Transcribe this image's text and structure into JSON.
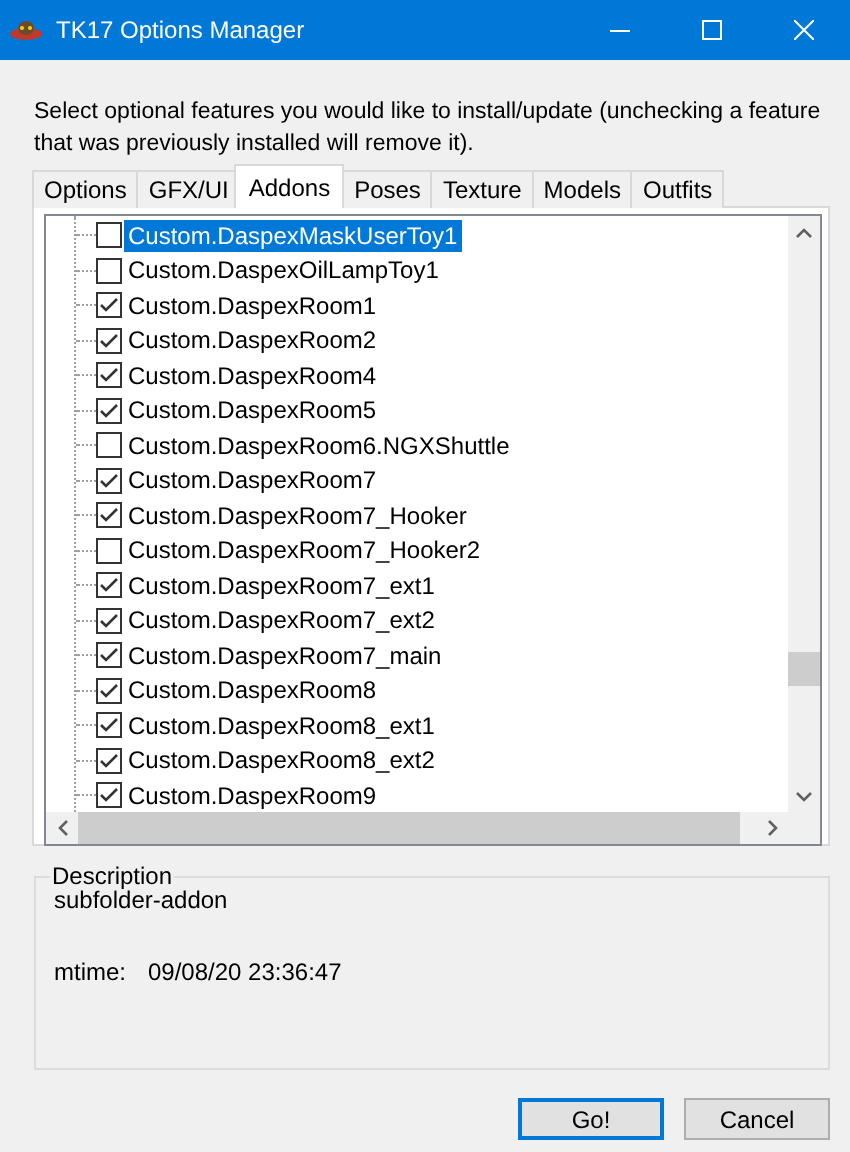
{
  "window": {
    "title": "TK17 Options Manager"
  },
  "instructions": "Select optional features you would like to install/update (unchecking a feature that was previously installed will remove it).",
  "tabs": [
    {
      "label": "Options",
      "selected": false
    },
    {
      "label": "GFX/UI",
      "selected": false
    },
    {
      "label": "Addons",
      "selected": true
    },
    {
      "label": "Poses",
      "selected": false
    },
    {
      "label": "Texture",
      "selected": false
    },
    {
      "label": "Models",
      "selected": false
    },
    {
      "label": "Outfits",
      "selected": false
    }
  ],
  "tree": {
    "items": [
      {
        "label": "Custom.DaspexMaskUserToy1",
        "checked": false,
        "selected": true
      },
      {
        "label": "Custom.DaspexOilLampToy1",
        "checked": false,
        "selected": false
      },
      {
        "label": "Custom.DaspexRoom1",
        "checked": true,
        "selected": false
      },
      {
        "label": "Custom.DaspexRoom2",
        "checked": true,
        "selected": false
      },
      {
        "label": "Custom.DaspexRoom4",
        "checked": true,
        "selected": false
      },
      {
        "label": "Custom.DaspexRoom5",
        "checked": true,
        "selected": false
      },
      {
        "label": "Custom.DaspexRoom6.NGXShuttle",
        "checked": false,
        "selected": false
      },
      {
        "label": "Custom.DaspexRoom7",
        "checked": true,
        "selected": false
      },
      {
        "label": "Custom.DaspexRoom7_Hooker",
        "checked": true,
        "selected": false
      },
      {
        "label": "Custom.DaspexRoom7_Hooker2",
        "checked": false,
        "selected": false
      },
      {
        "label": "Custom.DaspexRoom7_ext1",
        "checked": true,
        "selected": false
      },
      {
        "label": "Custom.DaspexRoom7_ext2",
        "checked": true,
        "selected": false
      },
      {
        "label": "Custom.DaspexRoom7_main",
        "checked": true,
        "selected": false
      },
      {
        "label": "Custom.DaspexRoom8",
        "checked": true,
        "selected": false
      },
      {
        "label": "Custom.DaspexRoom8_ext1",
        "checked": true,
        "selected": false
      },
      {
        "label": "Custom.DaspexRoom8_ext2",
        "checked": true,
        "selected": false
      },
      {
        "label": "Custom.DaspexRoom9",
        "checked": true,
        "selected": false
      }
    ]
  },
  "description": {
    "legend": "Description",
    "text": "subfolder-addon",
    "mtime_label": "mtime:",
    "mtime_value": "09/08/20 23:36:47"
  },
  "buttons": [
    {
      "label": "Go!",
      "kind": "default"
    },
    {
      "label": "Cancel",
      "kind": "normal"
    }
  ]
}
